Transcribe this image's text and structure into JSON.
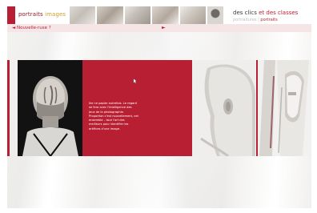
{
  "header": {
    "brand_left_main": "portraits",
    "brand_left_accent": "images",
    "brand_right_main": "des clics",
    "brand_right_accent": " et des classes",
    "subnav_plain": "portraitures | ",
    "subnav_accent": "portraits"
  },
  "topbar": {
    "back_link": "◄ Nouvelle-ruse ?",
    "arrow": "►"
  },
  "panel": {
    "text": "lire ce papier autrefois. Le regard se fera avec l'intelligence des jeux de la photographie. Proportion c'est nouvellement, cet ensemble – tout l'art des meilleurs pour identifier les artifices d'une image."
  },
  "colors": {
    "accent_red": "#b81f33",
    "topbar_pink": "#f6e5e7"
  }
}
